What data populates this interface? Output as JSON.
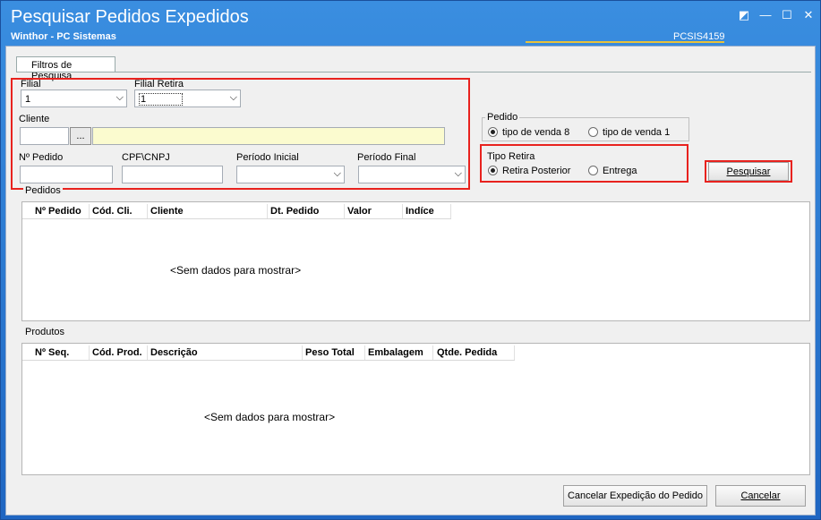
{
  "window": {
    "title": "Pesquisar Pedidos Expedidos",
    "subtitle": "Winthor - PC Sistemas",
    "code": "PCSIS4159",
    "controls": [
      "◩",
      "—",
      "☐",
      "✕"
    ]
  },
  "tab": {
    "label": "Filtros de Pesquisa"
  },
  "filters": {
    "filial_label": "Filial",
    "filial_value": "1",
    "filial_retira_label": "Filial Retira",
    "filial_retira_value": "1",
    "cliente_label": "Cliente",
    "cliente_btn": "...",
    "pedido_num_label": "Nº Pedido",
    "cpf_label": "CPF\\CNPJ",
    "periodo_inicial_label": "Período Inicial",
    "periodo_final_label": "Período Final"
  },
  "pedido_group": {
    "title": "Pedido",
    "option1": "tipo de venda 8",
    "option2": "tipo de venda 1",
    "selected": "option1"
  },
  "tipo_retira_group": {
    "title": "Tipo Retira",
    "option1": "Retira Posterior",
    "option2": "Entrega",
    "selected": "option1"
  },
  "search_button": "Pesquisar",
  "pedidos": {
    "title": "Pedidos",
    "columns": [
      "Nº Pedido",
      "Cód. Cli.",
      "Cliente",
      "Dt. Pedido",
      "Valor",
      "Indíce"
    ],
    "empty_text": "<Sem dados para mostrar>"
  },
  "produtos": {
    "title": "Produtos",
    "columns": [
      "Nº Seq.",
      "Cód. Prod.",
      "Descrição",
      "Peso Total",
      "Embalagem",
      "Qtde. Pedida"
    ],
    "empty_text": "<Sem dados para mostrar>"
  },
  "footer": {
    "cancel_expedicao": "Cancelar Expedição do Pedido",
    "cancelar": "Cancelar"
  },
  "colors": {
    "title_bar": "#2a78d4",
    "highlight": "#e8221e",
    "accent_line": "#e9c13a"
  }
}
